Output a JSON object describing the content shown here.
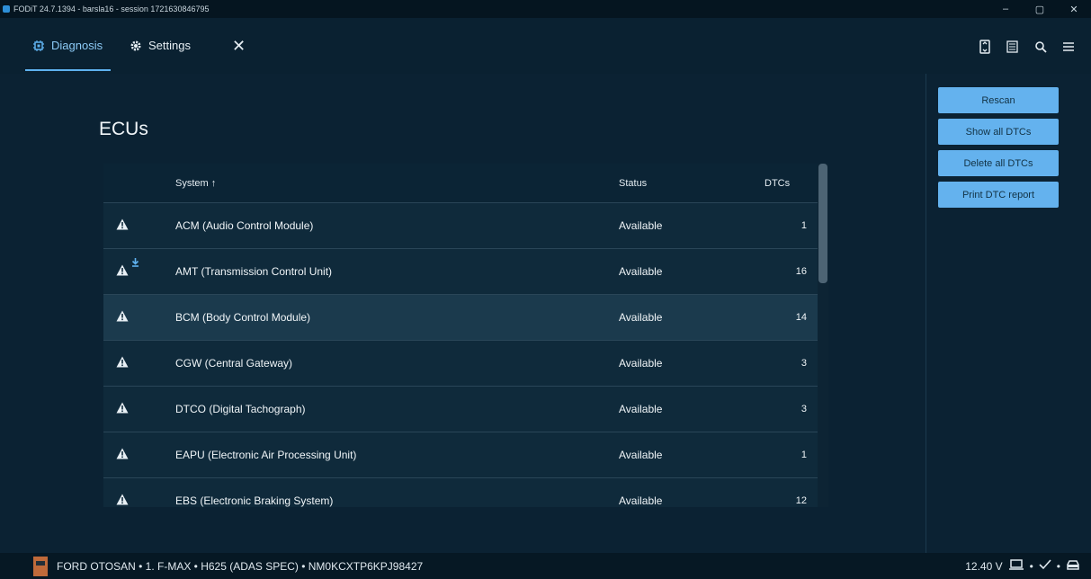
{
  "window": {
    "title": "FODiT 24.7.1394 - barsla16 - session 1721630846795",
    "controls": [
      "–",
      "▢",
      "✕"
    ]
  },
  "tabs": [
    {
      "label": "Diagnosis",
      "icon": "chip-icon"
    },
    {
      "label": "Settings",
      "icon": "gear-icon"
    }
  ],
  "close_symbol": "✕",
  "toolbar_icons": [
    "ecu-icon",
    "table-icon",
    "search-icon",
    "menu-icon"
  ],
  "actions": {
    "rescan": "Rescan",
    "show_all": "Show all DTCs",
    "delete_all": "Delete all DTCs",
    "print_report": "Print DTC report"
  },
  "page": {
    "title": "ECUs"
  },
  "table": {
    "headers": {
      "system": "System ↑",
      "status": "Status",
      "dtcs": "DTCs"
    },
    "rows": [
      {
        "system": "ACM (Audio Control Module)",
        "status": "Available",
        "dtcs": "1",
        "download": false,
        "selected": false
      },
      {
        "system": "AMT (Transmission Control Unit)",
        "status": "Available",
        "dtcs": "16",
        "download": true,
        "selected": false
      },
      {
        "system": "BCM (Body Control Module)",
        "status": "Available",
        "dtcs": "14",
        "download": false,
        "selected": true
      },
      {
        "system": "CGW (Central Gateway)",
        "status": "Available",
        "dtcs": "3",
        "download": false,
        "selected": false
      },
      {
        "system": "DTCO (Digital Tachograph)",
        "status": "Available",
        "dtcs": "3",
        "download": false,
        "selected": false
      },
      {
        "system": "EAPU (Electronic Air Processing Unit)",
        "status": "Available",
        "dtcs": "1",
        "download": false,
        "selected": false
      },
      {
        "system": "EBS (Electronic Braking System)",
        "status": "Available",
        "dtcs": "12",
        "download": false,
        "selected": false
      }
    ]
  },
  "status_bar": {
    "vehicle": "FORD OTOSAN • 1. F-MAX • H625 (ADAS SPEC) • NM0KCXTP6KPJ98427",
    "voltage": "12.40 V",
    "sep": "•"
  },
  "colors": {
    "accent": "#5fb2f0",
    "button": "#64b2ee",
    "background": "#0b2233"
  }
}
